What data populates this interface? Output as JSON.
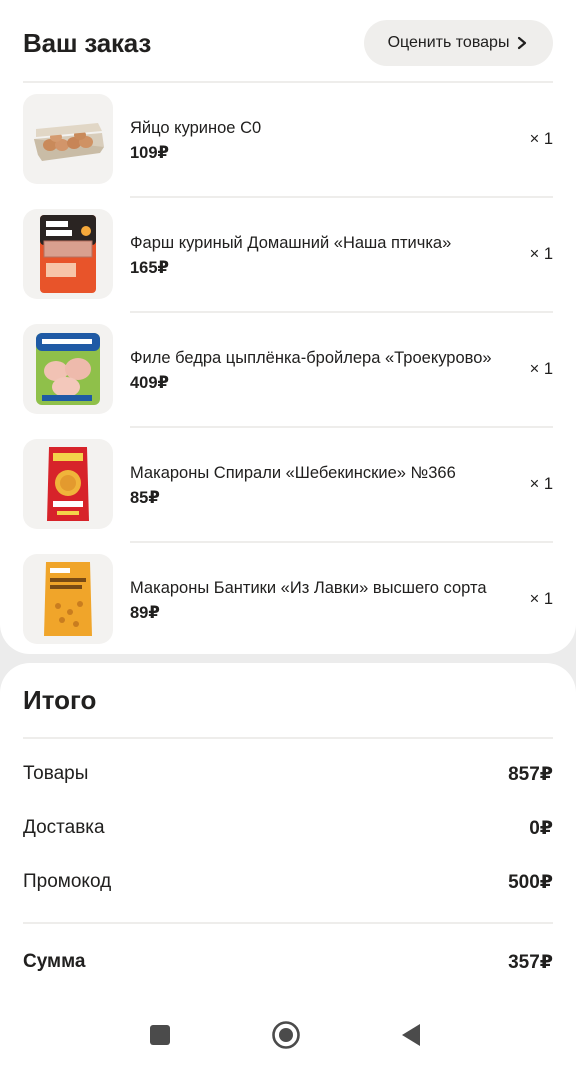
{
  "order": {
    "title": "Ваш заказ",
    "rate_button_label": "Оценить товары",
    "items": [
      {
        "name": "Яйцо куриное С0",
        "price": "109₽",
        "qty": "× 1",
        "image": "eggs-carton"
      },
      {
        "name": "Фарш куриный Домашний «Наша птичка»",
        "price": "165₽",
        "qty": "× 1",
        "image": "minced-chicken-tray"
      },
      {
        "name": "Филе бедра цыплёнка-бройлера «Троекурово»",
        "price": "409₽",
        "qty": "× 1",
        "image": "chicken-thigh-tray"
      },
      {
        "name": "Макароны Спирали «Шебекинские» №366",
        "price": "85₽",
        "qty": "× 1",
        "image": "pasta-red-pack"
      },
      {
        "name": "Макароны Бантики «Из Лавки» высшего сорта",
        "price": "89₽",
        "qty": "× 1",
        "image": "pasta-yellow-pack"
      }
    ]
  },
  "totals": {
    "title": "Итого",
    "goods_label": "Товары",
    "goods_value": "857₽",
    "delivery_label": "Доставка",
    "delivery_value": "0₽",
    "promo_label": "Промокод",
    "promo_value": "500₽",
    "sum_label": "Сумма",
    "sum_value": "357₽"
  },
  "navbar": {
    "icons": [
      "recent-apps-icon",
      "home-icon",
      "back-icon"
    ]
  },
  "colors": {
    "background": "#ececec",
    "card": "#ffffff",
    "button_bg": "#efeeec",
    "text": "#21201f"
  }
}
